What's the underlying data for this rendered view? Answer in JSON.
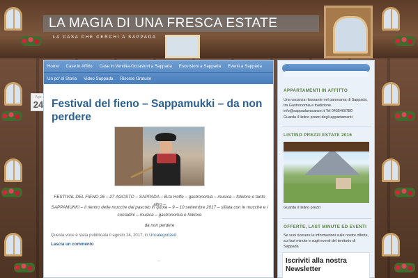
{
  "site": {
    "title": "LA MAGIA DI UNA FRESCA ESTATE",
    "tagline": "LA CASA CHE CERCHI A SAPPADA"
  },
  "nav": {
    "row1": [
      "Home",
      "Case in Affitto",
      "Case in Vendita-Occasioni a Sappada",
      "Escursioni a Sappada",
      "Eventi a Sappada"
    ],
    "row2": [
      "Un po' di Storia",
      "Video Sappada",
      "Risorse Gratuite"
    ]
  },
  "post": {
    "date_month": "Ago",
    "date_day": "24",
    "title": "Festival del fieno – Sappamukki – da non perdere",
    "paragraphs": [
      "FESTIVAL DEL FIENO 26 – 27 AGOSTO – SAPPADA – B.ta Hoffe – gastronomia – musica – folklore e tanto altro –",
      "SAPPAMUKKI  – il rientro delle mucche dal pascolo in quota – 9 – 10 settembre 2017 – sfilata con le mucche e i contadini – musica – gastronomia  e folklore",
      "da non perdere"
    ],
    "meta_prefix": "Questa voce è stata pubblicata il agosto 24, 2017, in",
    "meta_category": "Uncategorized",
    "comment_link": "Lascia un commento",
    "divider_glyph": "~"
  },
  "sidebar": {
    "search_placeholder": "",
    "widgets": {
      "apartments": {
        "title": "APPARTAMENTI IN AFFITTO",
        "text": "Una vacanza rilassante nel panorama di Sappada, tra Gastronomia e tradizione. info@sappadavacanze.it Tel 0435469780",
        "link": "Guarda il listino prezzi degli appartamenti"
      },
      "prices": {
        "title": "LISTINO PREZZI ESTATE 2016",
        "caption": "Guarda il listino prezzi"
      },
      "offers": {
        "title": "OFFERTE, LAST MINUTE ED EVENTI",
        "text": "Se vuoi ricevere le informazioni sulle nostre offerte, sui last minute e sugli eventi del territorio di Sappada"
      },
      "newsletter": {
        "title": "Iscriviti alla nostra Newsletter"
      }
    }
  },
  "colors": {
    "nav_blue": "#4a7fbd",
    "title_blue": "#2a5f8f",
    "widget_green": "#5a7f3f"
  }
}
